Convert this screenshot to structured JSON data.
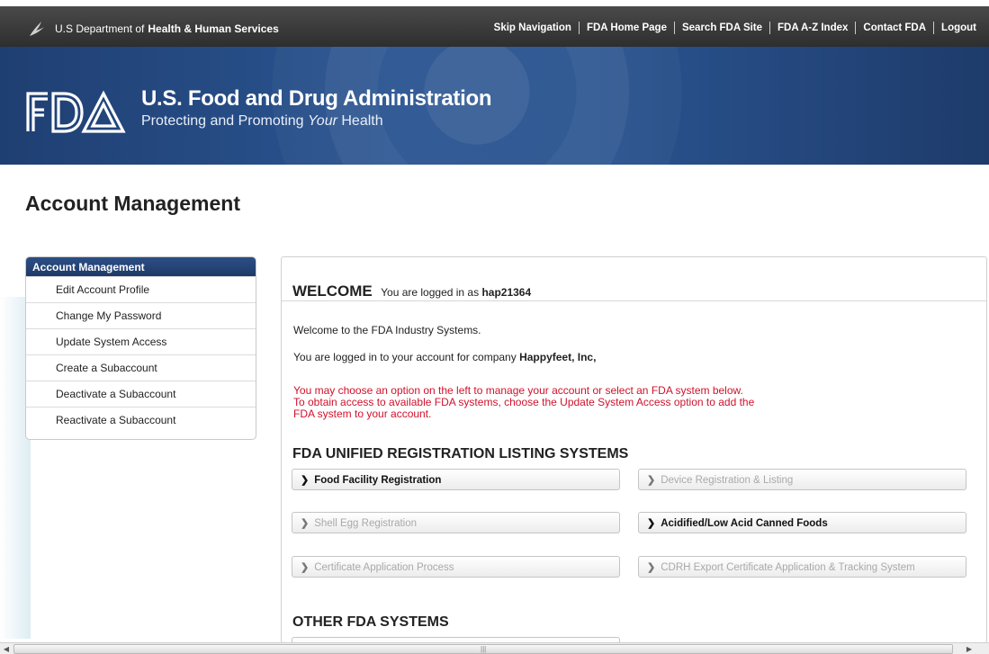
{
  "header": {
    "hhs_prefix": "U.S Department of",
    "hhs_bold": "Health & Human Services",
    "links": [
      "Skip Navigation",
      "FDA Home Page",
      "Search FDA Site",
      "FDA A-Z Index",
      "Contact FDA",
      "Logout"
    ]
  },
  "banner": {
    "agency_name": "U.S. Food and Drug Administration",
    "tagline_pre": "Protecting and Promoting ",
    "tagline_em": "Your",
    "tagline_post": " Health",
    "brand_color": "#1f3f72"
  },
  "page_title": "Account Management",
  "sidebar": {
    "title": "Account Management",
    "items": [
      "Edit Account Profile",
      "Change My Password",
      "Update System Access",
      "Create a Subaccount",
      "Deactivate a Subaccount",
      "Reactivate a Subaccount"
    ]
  },
  "main": {
    "welcome": "WELCOME",
    "logged_in_prefix": "You are logged in as",
    "username": "hap21364",
    "intro": "Welcome to the FDA Industry Systems.",
    "company_prefix": "You are logged in to your account for company",
    "company": "Happyfeet, Inc,",
    "notice_line1": "You may choose an option on the left to manage your account or select an FDA system below.",
    "notice_line2": "To obtain access to available FDA systems, choose the Update System Access option to add the",
    "notice_line3": "FDA system to your account.",
    "notice_color": "#d0112b",
    "section1": "FDA UNIFIED REGISTRATION LISTING SYSTEMS",
    "section2": "OTHER FDA SYSTEMS",
    "systems": [
      {
        "label": "Food Facility Registration",
        "enabled": true
      },
      {
        "label": "Device Registration & Listing",
        "enabled": false
      },
      {
        "label": "Shell Egg Registration",
        "enabled": false
      },
      {
        "label": "Acidified/Low Acid Canned Foods",
        "enabled": true
      },
      {
        "label": "Certificate Application Process",
        "enabled": false
      },
      {
        "label": "CDRH Export Certificate Application & Tracking System",
        "enabled": false
      }
    ]
  },
  "icons": {
    "hhs": "eagle-icon",
    "chevron": "chevron-right-icon"
  }
}
